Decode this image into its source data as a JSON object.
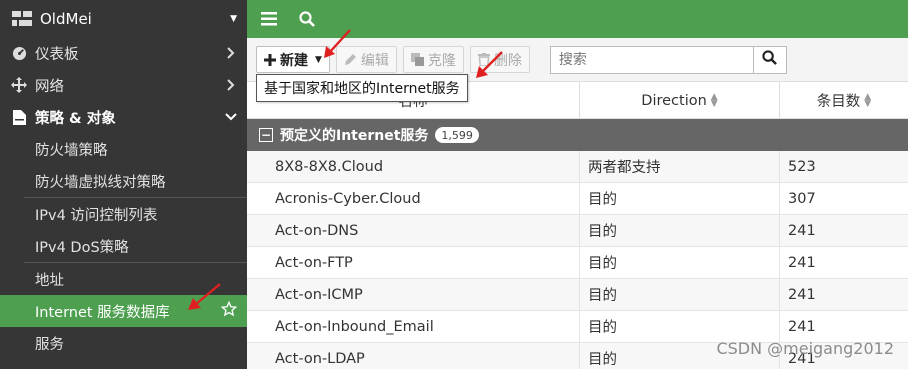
{
  "sidebar": {
    "device_name": "OldMei",
    "items": [
      {
        "label": "仪表板"
      },
      {
        "label": "网络"
      },
      {
        "label": "策略 & 对象"
      }
    ],
    "sub_items": [
      {
        "label": "防火墙策略"
      },
      {
        "label": "防火墙虚拟线对策略"
      },
      {
        "label": "IPv4 访问控制列表"
      },
      {
        "label": "IPv4 DoS策略"
      },
      {
        "label": "地址"
      },
      {
        "label": "Internet 服务数据库"
      },
      {
        "label": "服务"
      }
    ]
  },
  "toolbar": {
    "new_label": "新建",
    "edit_label": "编辑",
    "clone_label": "克隆",
    "delete_label": "删除",
    "search_placeholder": "搜索"
  },
  "tooltip": {
    "text": "基于国家和地区的Internet服务"
  },
  "table": {
    "columns": [
      "名称",
      "Direction",
      "条目数"
    ],
    "group": {
      "label": "预定义的Internet服务",
      "count": "1,599"
    },
    "rows": [
      {
        "name": "8X8-8X8.Cloud",
        "direction": "两者都支持",
        "entries": "523"
      },
      {
        "name": "Acronis-Cyber.Cloud",
        "direction": "目的",
        "entries": "307"
      },
      {
        "name": "Act-on-DNS",
        "direction": "目的",
        "entries": "241"
      },
      {
        "name": "Act-on-FTP",
        "direction": "目的",
        "entries": "241"
      },
      {
        "name": "Act-on-ICMP",
        "direction": "目的",
        "entries": "241"
      },
      {
        "name": "Act-on-Inbound_Email",
        "direction": "目的",
        "entries": "241"
      },
      {
        "name": "Act-on-LDAP",
        "direction": "目的",
        "entries": "241"
      }
    ]
  },
  "watermark": "CSDN @meigang2012",
  "colors": {
    "accent": "#4ea050",
    "sidebar_bg": "#363636",
    "group_bg": "#666666",
    "annotation_arrow": "#e02020"
  }
}
